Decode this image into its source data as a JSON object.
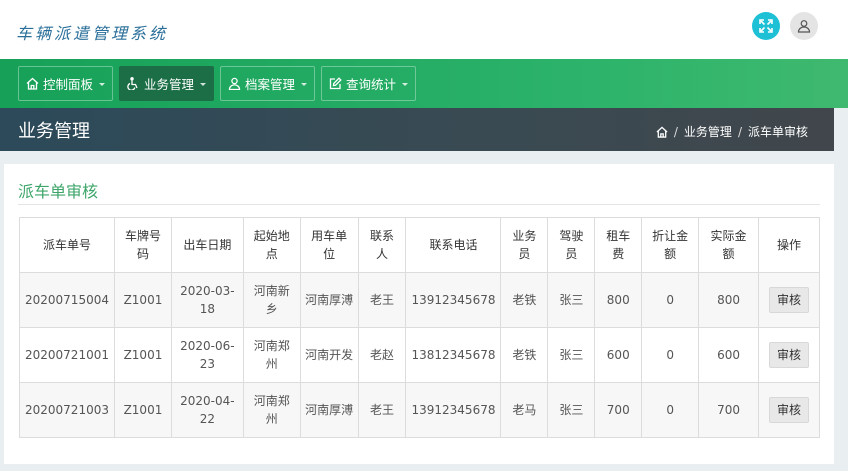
{
  "app": {
    "brand": "车辆派遣管理系统"
  },
  "header_icons": [
    {
      "name": "fullscreen-icon",
      "color": "#1ec0d6"
    },
    {
      "name": "user-icon",
      "color": "#e4e4e4"
    }
  ],
  "nav": {
    "items": [
      {
        "label": "控制面板",
        "icon": "home-icon",
        "active": false
      },
      {
        "label": "业务管理",
        "icon": "wheelchair-icon",
        "active": true
      },
      {
        "label": "档案管理",
        "icon": "user-icon",
        "active": false
      },
      {
        "label": "查询统计",
        "icon": "edit-icon",
        "active": false
      }
    ]
  },
  "page": {
    "title": "业务管理"
  },
  "breadcrumb": {
    "items": [
      "业务管理",
      "派车单审核"
    ],
    "separator": "/"
  },
  "panel": {
    "title": "派车单审核"
  },
  "table": {
    "headers": [
      "派车单号",
      "车牌号码",
      "出车日期",
      "起始地点",
      "用车单位",
      "联系人",
      "联系电话",
      "业务员",
      "驾驶员",
      "租车费",
      "折让金额",
      "实际金额",
      "操作"
    ],
    "rows": [
      [
        "20200715004",
        "Z1001",
        "2020-03-18",
        "河南新乡",
        "河南厚溥",
        "老王",
        "13912345678",
        "老铁",
        "张三",
        "800",
        "0",
        "800"
      ],
      [
        "20200721001",
        "Z1001",
        "2020-06-23",
        "河南郑州",
        "河南开发",
        "老赵",
        "13812345678",
        "老铁",
        "张三",
        "600",
        "0",
        "600"
      ],
      [
        "20200721003",
        "Z1001",
        "2020-04-22",
        "河南郑州",
        "河南厚溥",
        "老王",
        "13912345678",
        "老马",
        "张三",
        "700",
        "0",
        "700"
      ]
    ],
    "action_label": "审核"
  }
}
